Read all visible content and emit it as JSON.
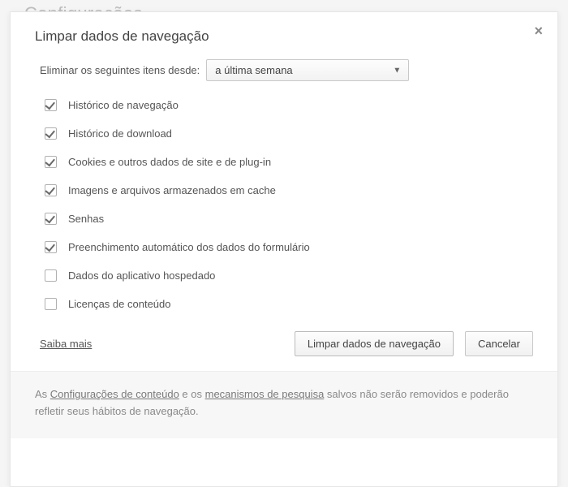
{
  "background": {
    "title": "Configurações"
  },
  "dialog": {
    "title": "Limpar dados de navegação",
    "close_glyph": "×",
    "time_label": "Eliminar os seguintes itens desde:",
    "time_selected": "a última semana",
    "items": [
      {
        "label": "Histórico de navegação",
        "checked": true
      },
      {
        "label": "Histórico de download",
        "checked": true
      },
      {
        "label": "Cookies e outros dados de site e de plug-in",
        "checked": true
      },
      {
        "label": "Imagens e arquivos armazenados em cache",
        "checked": true
      },
      {
        "label": "Senhas",
        "checked": true
      },
      {
        "label": "Preenchimento automático dos dados do formulário",
        "checked": true
      },
      {
        "label": "Dados do aplicativo hospedado",
        "checked": false
      },
      {
        "label": "Licenças de conteúdo",
        "checked": false
      }
    ],
    "learn_more": "Saiba mais",
    "primary_button": "Limpar dados de navegação",
    "cancel_button": "Cancelar",
    "disclaimer": {
      "prefix": "As ",
      "link1": "Configurações de conteúdo",
      "mid": " e os ",
      "link2": "mecanismos de pesquisa",
      "suffix": " salvos não serão removidos e poderão refletir seus hábitos de navegação."
    }
  }
}
